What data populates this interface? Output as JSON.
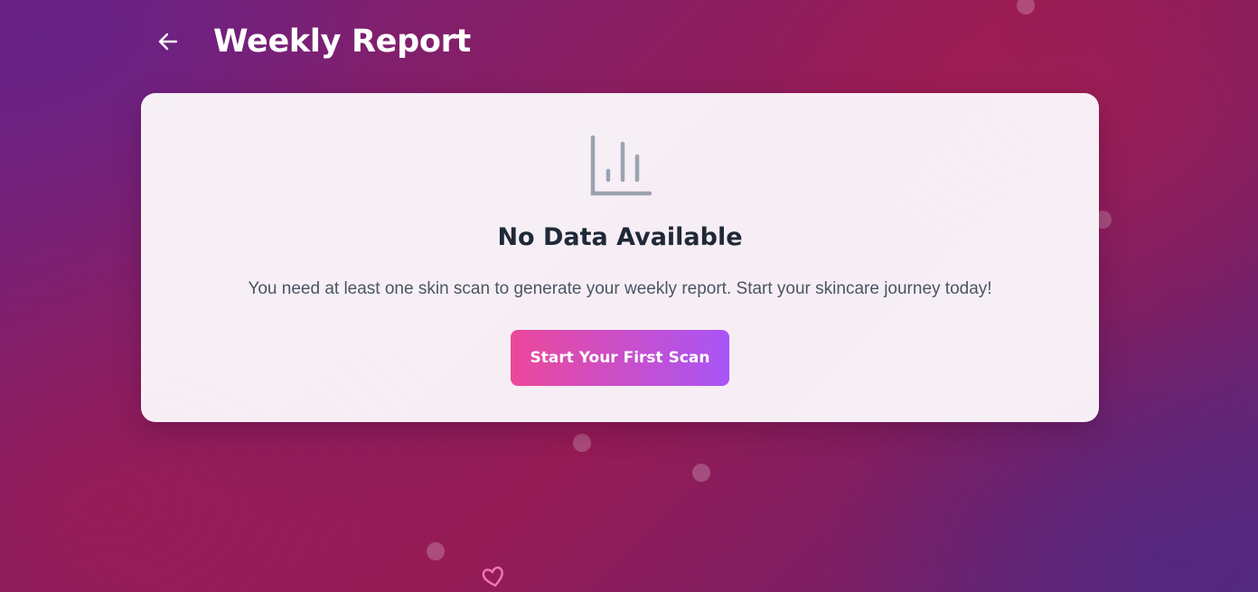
{
  "header": {
    "back_icon": "arrow-left-icon",
    "title": "Weekly Report"
  },
  "empty_state": {
    "icon": "bar-chart-icon",
    "title": "No Data Available",
    "description": "You need at least one skin scan to generate your weekly report. Start your skincare journey today!",
    "button_label": "Start Your First Scan"
  },
  "decorations": {
    "heart_icon": "heart-icon"
  },
  "colors": {
    "accent_start": "#ec4899",
    "accent_end": "#a855f7",
    "icon_gray": "#9ca3af",
    "title_dark": "#1f2937",
    "text_gray": "#4b5563"
  }
}
